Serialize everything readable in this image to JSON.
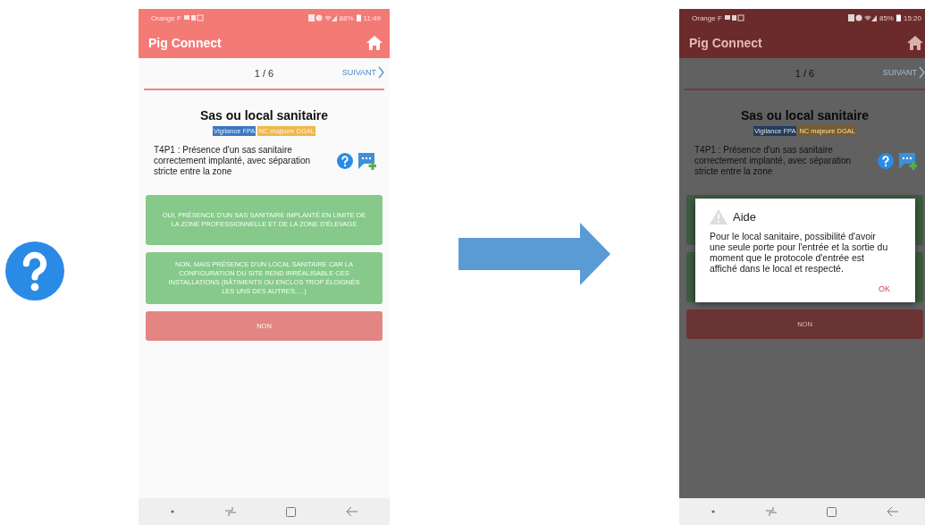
{
  "screens": [
    {
      "dimmed": false,
      "status_bar": {
        "carrier": "Orange F",
        "battery": "88%",
        "time": "11:49"
      },
      "app_bar": {
        "title": "Pig Connect"
      },
      "pager": {
        "position": "1 / 6",
        "next": "SUIVANT"
      },
      "question": {
        "title": "Sas ou local sanitaire",
        "tags": [
          {
            "label": "Vigilance FPA",
            "color": "#3b78c2"
          },
          {
            "label": "NC majeure DGAL",
            "color": "#f0b84e"
          }
        ],
        "text": "T4P1 : Présence d'un sas sanitaire correctement implanté, avec séparation stricte entre la zone"
      },
      "answers": [
        {
          "label": "OUI, PRÉSENCE D'UN SAS SANITAIRE IMPLANTÉ EN LIMITE DE LA ZONE PROFESSIONNELLE ET DE LA ZONE D'ÉLEVAGE",
          "kind": "positive"
        },
        {
          "label": "NON, MAIS PRÉSENCE D'UN LOCAL SANITAIRE CAR LA CONFIGURATION DU SITE REND IRRÉALISABLE CES INSTALLATIONS (BÂTIMENTS OU ENCLOS TROP ÉLOIGNÉS LES UNS DES AUTRES, ...)",
          "kind": "positive"
        },
        {
          "label": "NON",
          "kind": "negative"
        }
      ]
    },
    {
      "dimmed": true,
      "status_bar": {
        "carrier": "Orange F",
        "battery": "85%",
        "time": "15:20"
      },
      "app_bar": {
        "title": "Pig Connect"
      },
      "pager": {
        "position": "1 / 6",
        "next": "SUIVANT"
      },
      "question": {
        "title": "Sas ou local sanitaire",
        "tags": [
          {
            "label": "Vigilance FPA",
            "color": "#1f3d63"
          },
          {
            "label": "NC majeure DGAL",
            "color": "#7a5c26"
          }
        ],
        "text": "T4P1 : Présence d'un sas sanitaire correctement implanté, avec séparation stricte entre la zone"
      },
      "answers": [
        {
          "kind": "positive"
        },
        {
          "kind": "positive"
        },
        {
          "label": "NON",
          "kind": "negative"
        }
      ],
      "dialog": {
        "title": "Aide",
        "text": "Pour le local sanitaire, possibilité d'avoir une seule porte pour l'entrée et la sortie du moment que le protocole d'entrée est affiché dans le local et respecté.",
        "button": "OK"
      }
    }
  ]
}
